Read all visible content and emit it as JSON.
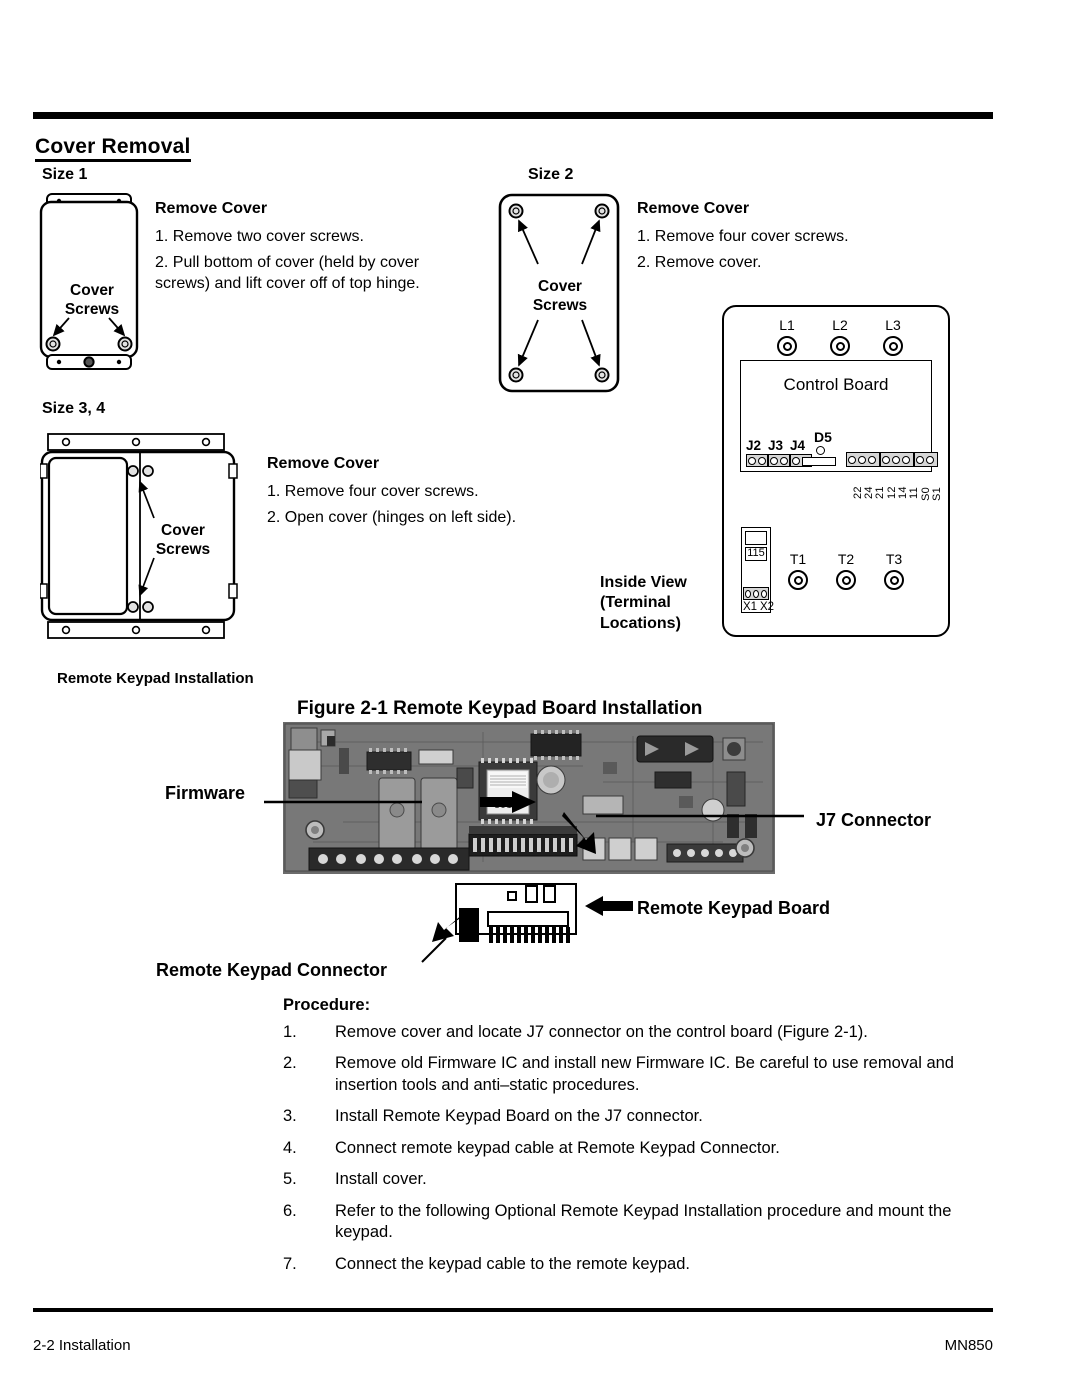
{
  "document": {
    "section_title": "Cover Removal",
    "footer_left": "2-2 Installation",
    "footer_right": "MN850"
  },
  "cover_removal": {
    "size1": {
      "size_label": "Size 1",
      "heading": "Remove Cover",
      "step1": "1. Remove  two cover screws.",
      "step2": "2. Pull bottom of cover (held by cover screws) and lift cover off of top hinge.",
      "screw_callout": "Cover\nScrews"
    },
    "size2": {
      "size_label": "Size 2",
      "heading": "Remove Cover",
      "step1": "1. Remove  four cover screws.",
      "step2": "2. Remove cover.",
      "screw_callout": "Cover\nScrews"
    },
    "size34": {
      "size_label": "Size 3, 4",
      "heading": "Remove Cover",
      "step1": "1. Remove  four cover screws.",
      "step2": "2. Open cover (hinges on left side).",
      "screw_callout": "Cover\nScrews"
    }
  },
  "control_board": {
    "title": "Control Board",
    "inside_view_label": "Inside View\n(Terminal\nLocations)",
    "line_terminals": [
      "L1",
      "L2",
      "L3"
    ],
    "motor_terminals": [
      "T1",
      "T2",
      "T3"
    ],
    "jumpers": [
      "J2",
      "J3",
      "J4"
    ],
    "led": "D5",
    "terminal_numbers": [
      "22",
      "24",
      "21",
      "12",
      "14",
      "11",
      "S0",
      "S1"
    ],
    "voltage_select": "115",
    "transformer_terminals": [
      "X1",
      "X2"
    ]
  },
  "figure": {
    "sub_heading": "Remote Keypad Installation",
    "caption": "Figure 2-1  Remote Keypad Board Installation",
    "callout_firmware": "Firmware",
    "callout_j7": "J7 Connector",
    "callout_keypad_board": "Remote Keypad Board",
    "callout_keypad_connector": "Remote Keypad Connector",
    "ic_marking": "8018"
  },
  "procedure": {
    "heading": "Procedure:",
    "steps": [
      {
        "num": "1.",
        "text": "Remove cover and locate J7 connector on the control board (Figure 2-1)."
      },
      {
        "num": "2.",
        "text": "Remove old Firmware IC and install new Firmware IC. Be careful to use removal and insertion tools and anti–static procedures."
      },
      {
        "num": "3.",
        "text": "Install Remote Keypad  Board on the J7 connector."
      },
      {
        "num": "4.",
        "text": "Connect remote keypad cable at Remote Keypad Connector."
      },
      {
        "num": "5.",
        "text": "Install cover."
      },
      {
        "num": "6.",
        "text": "Refer to the following Optional Remote Keypad Installation procedure and mount the keypad."
      },
      {
        "num": "7.",
        "text": "Connect the keypad cable to the remote keypad."
      }
    ]
  }
}
